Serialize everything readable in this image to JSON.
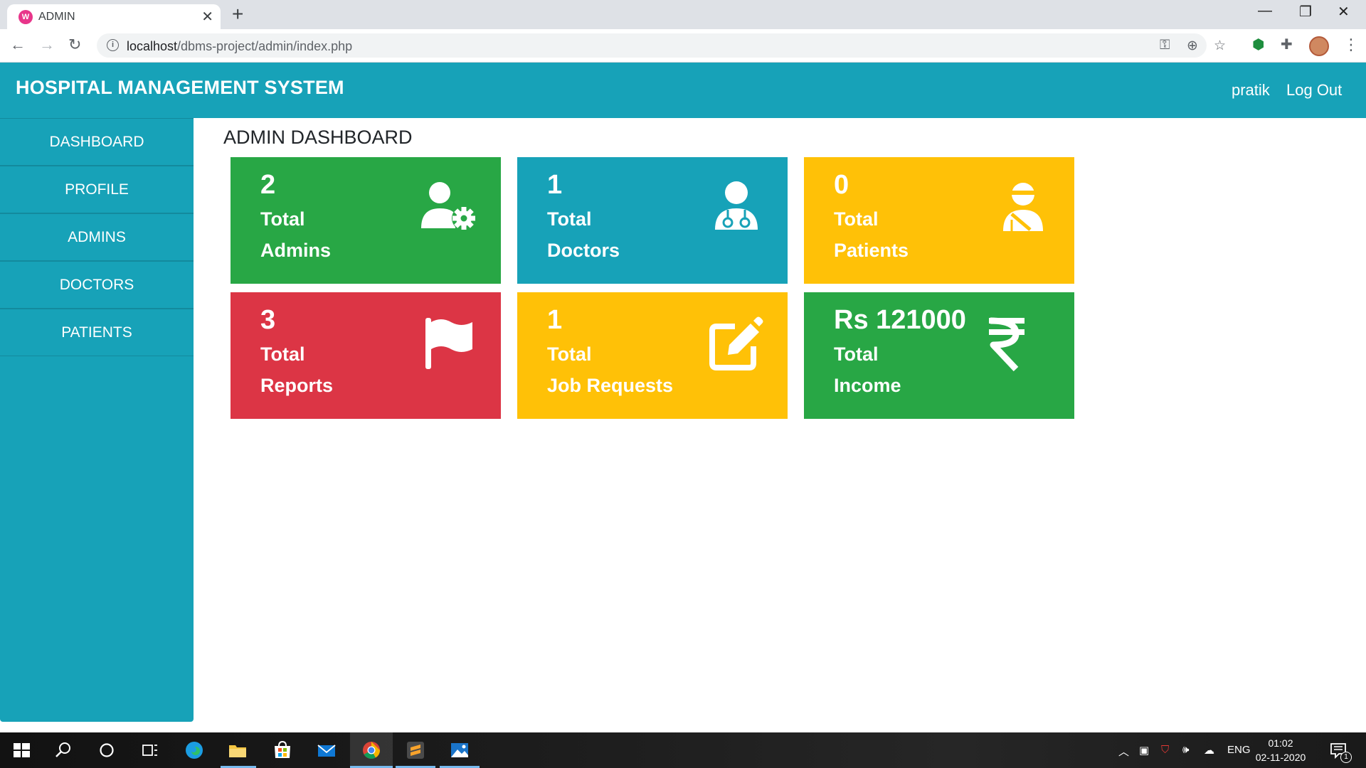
{
  "browser": {
    "tab_title": "ADMIN",
    "tab_favicon": "wamp-favicon-icon",
    "url_host": "localhost",
    "url_path": "/dbms-project/admin/index.php"
  },
  "header": {
    "brand": "HOSPITAL MANAGEMENT SYSTEM",
    "user_link": "pratik",
    "logout_link": "Log Out"
  },
  "sidebar": {
    "items": [
      {
        "label": "DASHBOARD"
      },
      {
        "label": "PROFILE"
      },
      {
        "label": "ADMINS"
      },
      {
        "label": "DOCTORS"
      },
      {
        "label": "PATIENTS"
      }
    ]
  },
  "main": {
    "title": "ADMIN DASHBOARD",
    "cards": [
      {
        "value": "2",
        "line1": "Total",
        "line2": "Admins",
        "icon": "user-gear-icon",
        "color": "#28a745"
      },
      {
        "value": "1",
        "line1": "Total",
        "line2": "Doctors",
        "icon": "doctor-icon",
        "color": "#17a2b8"
      },
      {
        "value": "0",
        "line1": "Total",
        "line2": "Patients",
        "icon": "injured-patient-icon",
        "color": "#ffc107"
      },
      {
        "value": "3",
        "line1": "Total",
        "line2": "Reports",
        "icon": "flag-icon",
        "color": "#dc3545"
      },
      {
        "value": "1",
        "line1": "Total",
        "line2": "Job Requests",
        "icon": "edit-icon",
        "color": "#ffc107"
      },
      {
        "value": "Rs 121000",
        "line1": "Total",
        "line2": "Income",
        "icon": "rupee-icon",
        "color": "#28a745"
      }
    ]
  },
  "taskbar": {
    "language": "ENG",
    "time": "01:02",
    "date": "02-11-2020",
    "notification_count": "1"
  },
  "colors": {
    "primary": "#17a2b8",
    "success": "#28a745",
    "warning": "#ffc107",
    "danger": "#dc3545"
  }
}
